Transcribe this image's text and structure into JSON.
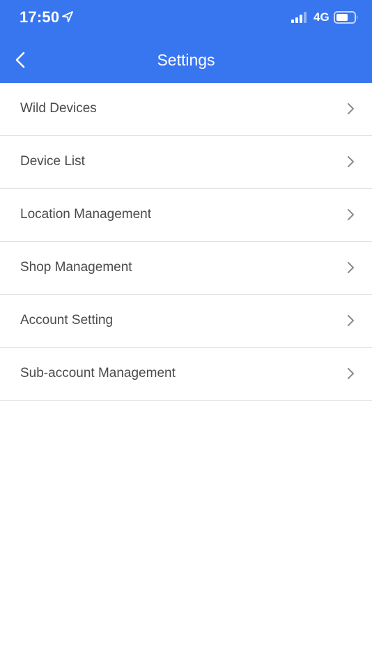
{
  "status_bar": {
    "time": "17:50",
    "network": "4G"
  },
  "nav": {
    "title": "Settings"
  },
  "menu": {
    "items": [
      {
        "label": "Wild Devices"
      },
      {
        "label": "Device List"
      },
      {
        "label": "Location Management"
      },
      {
        "label": "Shop Management"
      },
      {
        "label": "Account Setting"
      },
      {
        "label": "Sub-account Management"
      }
    ]
  },
  "icons": {
    "back": "chevron-left-icon",
    "row_arrow": "chevron-right-icon",
    "location": "location-arrow-icon",
    "signal": "signal-bars-icon",
    "battery": "battery-icon"
  },
  "colors": {
    "header_bg": "#3876f0",
    "header_text": "#ffffff",
    "item_text": "#4a4a4a",
    "chevron": "#8a8a8a",
    "divider": "#e3e3e3"
  }
}
